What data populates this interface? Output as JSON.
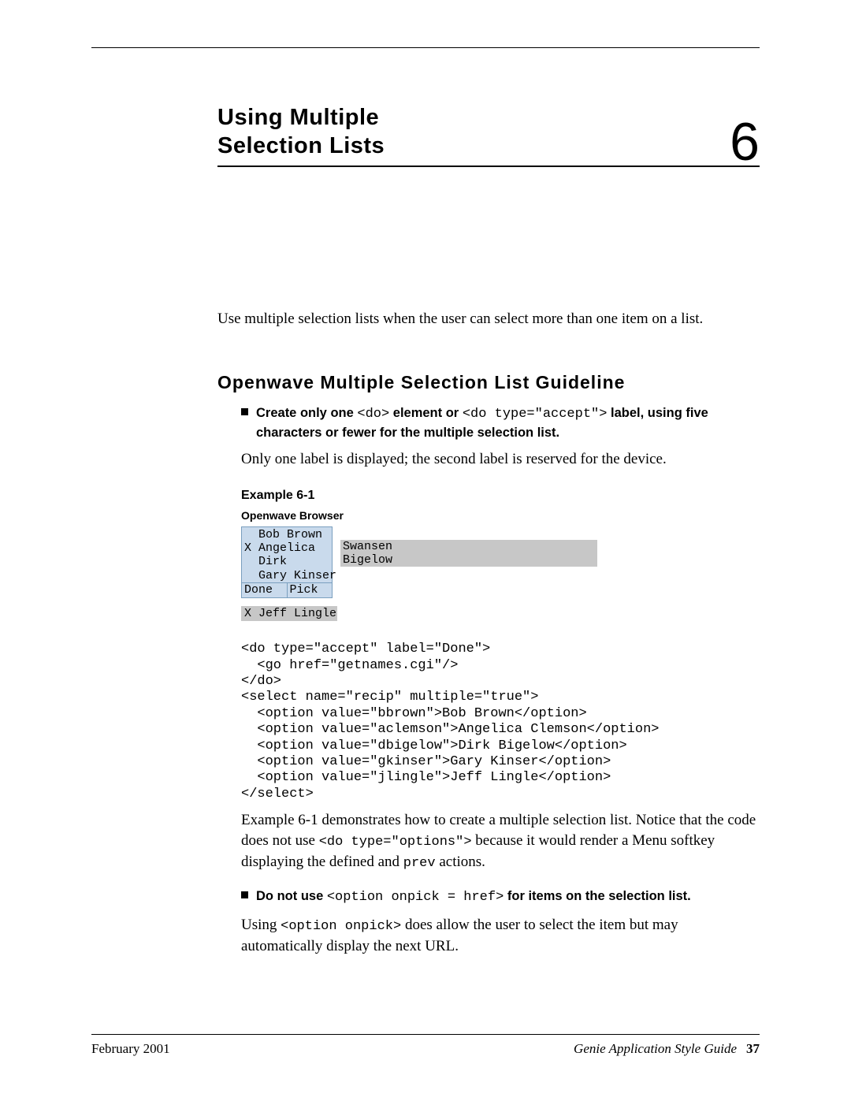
{
  "chapter": {
    "title_line1": "Using Multiple",
    "title_line2": "Selection Lists",
    "number": "6"
  },
  "intro": "Use multiple selection lists when the user can select more than one item on a list.",
  "section_heading": "Openwave Multiple Selection List Guideline",
  "bullet1": {
    "pre": "Create only one ",
    "code1": "<do>",
    "mid1": " element or ",
    "code2": "<do type=\"accept\">",
    "post": " label, using five characters or fewer for the multiple selection list."
  },
  "sub1": "Only one label is displayed; the second label is reserved for the device.",
  "example_label": "Example 6-1",
  "browser_label": "Openwave Browser",
  "screen": {
    "rows": [
      "  Bob Brown",
      "X Angelica",
      "  Dirk",
      "  Gary Kinser"
    ],
    "softkeys": {
      "left": "Done",
      "right": " Pick"
    },
    "right_rows": [
      "Swansen",
      "Bigelow"
    ],
    "extra": "X Jeff Lingle"
  },
  "code_block": "<do type=\"accept\" label=\"Done\">\n  <go href=\"getnames.cgi\"/>\n</do>\n<select name=\"recip\" multiple=\"true\">\n  <option value=\"bbrown\">Bob Brown</option>\n  <option value=\"aclemson\">Angelica Clemson</option>\n  <option value=\"dbigelow\">Dirk Bigelow</option>\n  <option value=\"gkinser\">Gary Kinser</option>\n  <option value=\"jlingle\">Jeff Lingle</option>\n</select>",
  "para_after_code": {
    "pre": "Example 6-1 demonstrates how to create a multiple selection list. Notice that the code does not use ",
    "code1": "<do type=\"options\">",
    "mid": " because it would render a Menu softkey displaying the defined and ",
    "code2": "prev",
    "post": " actions."
  },
  "bullet2": {
    "pre": "Do not use ",
    "code1": "<option onpick = href>",
    "post": " for items on the selection list."
  },
  "para_last": {
    "pre": "Using ",
    "code1": "<option onpick>",
    "post": " does allow the user to select the item but may automatically display the next URL."
  },
  "footer": {
    "left": "February 2001",
    "right_title": "Genie Application Style Guide",
    "page": "37"
  }
}
